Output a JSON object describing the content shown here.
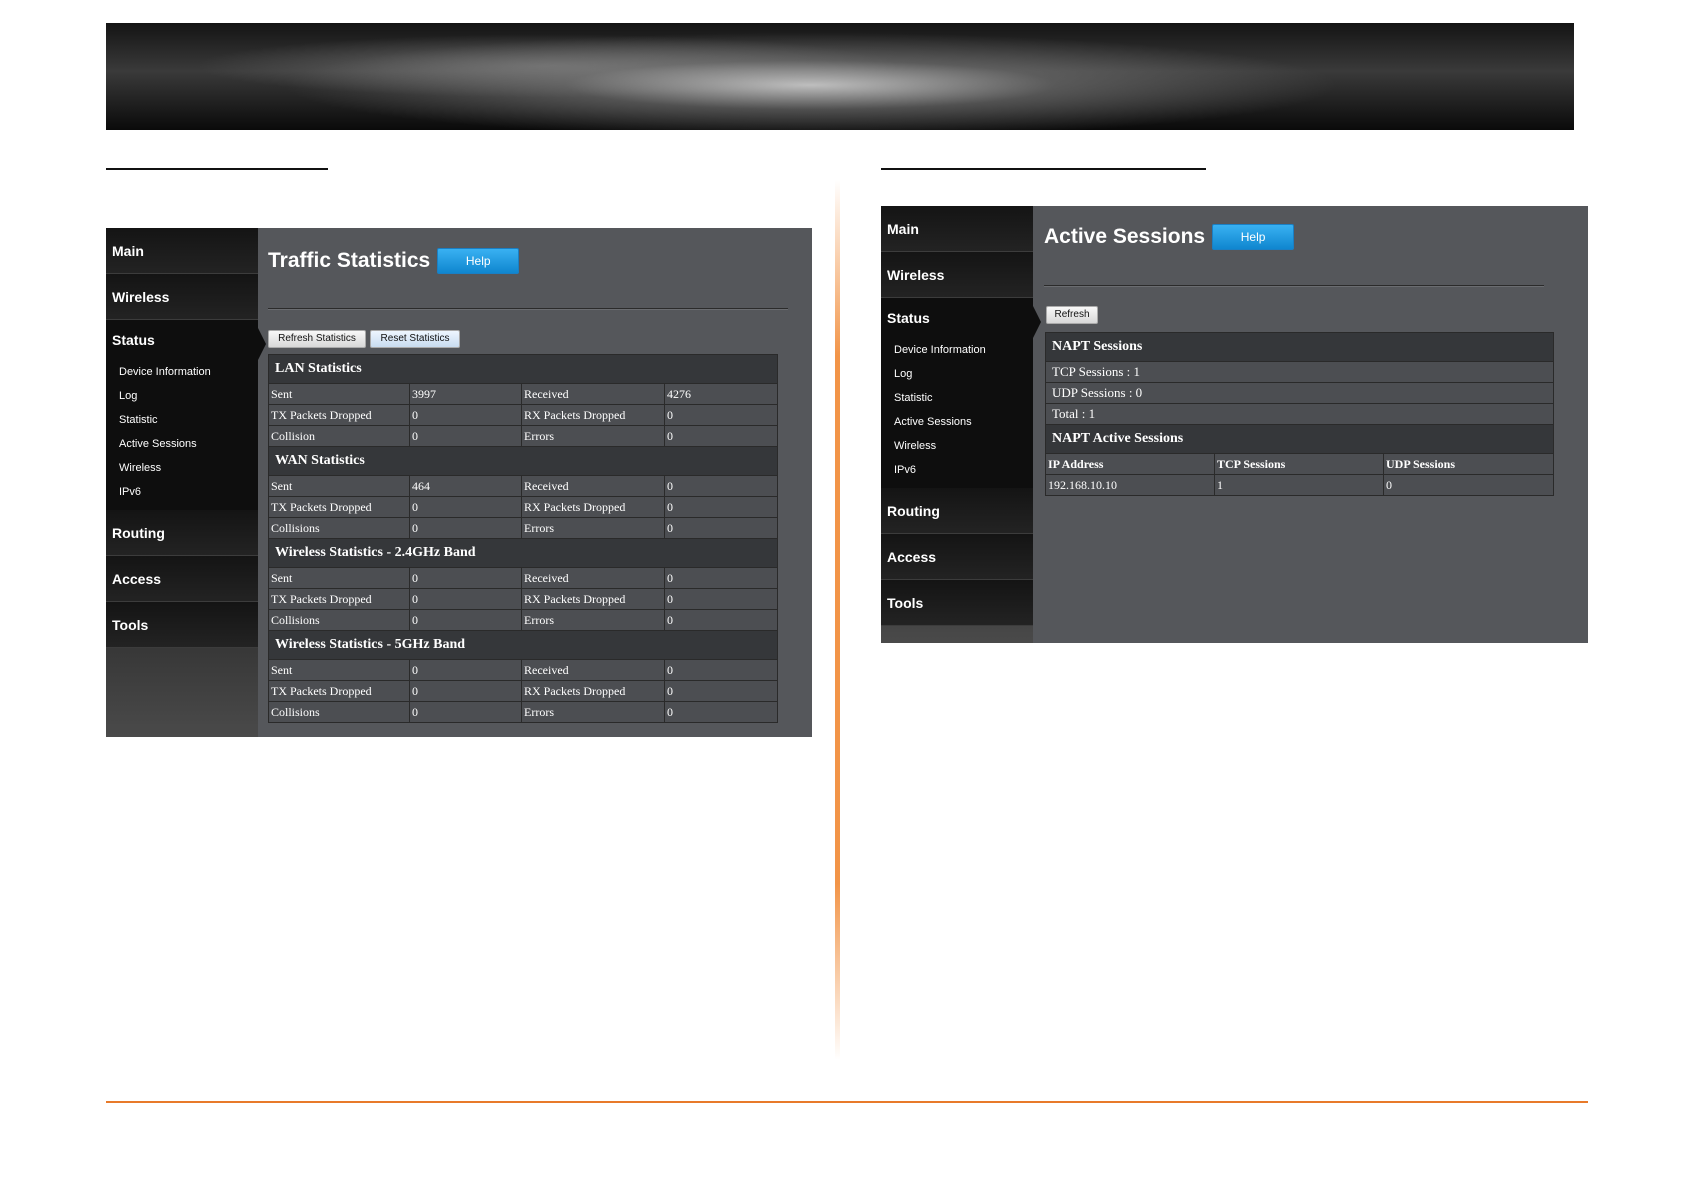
{
  "left_panel": {
    "nav": {
      "main": "Main",
      "wireless": "Wireless",
      "status": "Status",
      "sub": [
        "Device Information",
        "Log",
        "Statistic",
        "Active Sessions",
        "Wireless",
        "IPv6"
      ],
      "routing": "Routing",
      "access": "Access",
      "tools": "Tools"
    },
    "title": "Traffic Statistics",
    "help": "Help",
    "refresh_btn": "Refresh Statistics",
    "reset_btn": "Reset Statistics",
    "sections": [
      {
        "title": "LAN Statistics",
        "rows": [
          [
            "Sent",
            "3997",
            "Received",
            "4276"
          ],
          [
            "TX Packets Dropped",
            "0",
            "RX Packets Dropped",
            "0"
          ],
          [
            "Collision",
            "0",
            "Errors",
            "0"
          ]
        ]
      },
      {
        "title": "WAN Statistics",
        "rows": [
          [
            "Sent",
            "464",
            "Received",
            "0"
          ],
          [
            "TX Packets Dropped",
            "0",
            "RX Packets Dropped",
            "0"
          ],
          [
            "Collisions",
            "0",
            "Errors",
            "0"
          ]
        ]
      },
      {
        "title": "Wireless Statistics - 2.4GHz Band",
        "rows": [
          [
            "Sent",
            "0",
            "Received",
            "0"
          ],
          [
            "TX Packets Dropped",
            "0",
            "RX Packets Dropped",
            "0"
          ],
          [
            "Collisions",
            "0",
            "Errors",
            "0"
          ]
        ]
      },
      {
        "title": "Wireless Statistics - 5GHz Band",
        "rows": [
          [
            "Sent",
            "0",
            "Received",
            "0"
          ],
          [
            "TX Packets Dropped",
            "0",
            "RX Packets Dropped",
            "0"
          ],
          [
            "Collisions",
            "0",
            "Errors",
            "0"
          ]
        ]
      }
    ]
  },
  "right_panel": {
    "nav": {
      "main": "Main",
      "wireless": "Wireless",
      "status": "Status",
      "sub": [
        "Device Information",
        "Log",
        "Statistic",
        "Active Sessions",
        "Wireless",
        "IPv6"
      ],
      "routing": "Routing",
      "access": "Access",
      "tools": "Tools"
    },
    "title": "Active Sessions",
    "help": "Help",
    "refresh_btn": "Refresh",
    "napt_sessions": {
      "title": "NAPT Sessions",
      "tcp": "TCP Sessions : 1",
      "udp": "UDP Sessions : 0",
      "total": "Total : 1"
    },
    "napt_active": {
      "title": "NAPT Active Sessions",
      "headers": [
        "IP Address",
        "TCP Sessions",
        "UDP Sessions"
      ],
      "rows": [
        [
          "192.168.10.10",
          "1",
          "0"
        ]
      ]
    }
  }
}
